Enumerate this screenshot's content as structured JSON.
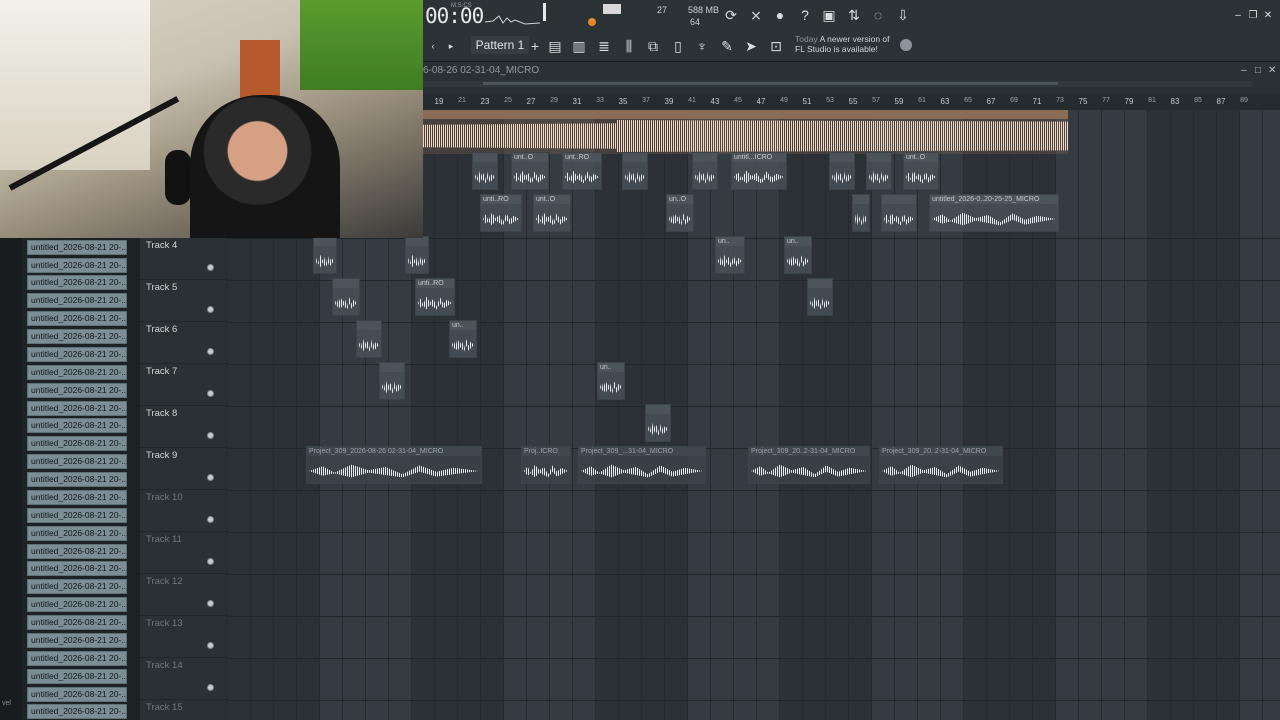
{
  "toolbar": {
    "time": "00:00",
    "time_unit": "M:S:CS",
    "tempo_value": "27",
    "memory": "588 MB",
    "cpu": "64",
    "pattern_label": "Pattern 1",
    "news_label": "Today",
    "news_text": "A newer version of FL Studio is available!"
  },
  "playlist": {
    "title": "6-08-26 02-31-04_MICRO"
  },
  "ruler": {
    "ticks": [
      "19",
      "21",
      "23",
      "25",
      "27",
      "29",
      "31",
      "33",
      "35",
      "37",
      "39",
      "41",
      "43",
      "45",
      "47",
      "49",
      "51",
      "53",
      "55",
      "57",
      "59",
      "61",
      "63",
      "65",
      "67",
      "69",
      "71",
      "73",
      "75",
      "77",
      "79",
      "81",
      "83",
      "85",
      "87",
      "89"
    ]
  },
  "browser": {
    "items": [
      "untitled_2026-08-21 20-...",
      "untitled_2026-08-21 20-...",
      "untitled_2026-08-21 20-...",
      "untitled_2026-08-21 20-...",
      "untitled_2026-08-21 20-...",
      "untitled_2026-08-21 20-...",
      "untitled_2026-08-21 20-...",
      "untitled_2026-08-21 20-...",
      "untitled_2026-08-21 20-...",
      "untitled_2026-08-21 20-...",
      "untitled_2026-08-21 20-...",
      "untitled_2026-08-21 20-...",
      "untitled_2026-08-21 20-...",
      "untitled_2026-08-21 20-...",
      "untitled_2026-08-21 20-...",
      "untitled_2026-08-21 20-...",
      "untitled_2026-08-21 20-...",
      "untitled_2026-08-21 20-...",
      "untitled_2026-08-21 20-...",
      "untitled_2026-08-21 20-...",
      "untitled_2026-08-21 20-...",
      "untitled_2026-08-21 20-...",
      "untitled_2026-08-21 20-...",
      "untitled_2026-08-21 20-...",
      "untitled_2026-08-21 20-...",
      "untitled_2026-08-21 20-...",
      "untitled_2026-08-21 20-..."
    ],
    "side_mark": "vel"
  },
  "tracks": [
    {
      "name": "Track 4",
      "active": true
    },
    {
      "name": "Track 5",
      "active": true
    },
    {
      "name": "Track 6",
      "active": true
    },
    {
      "name": "Track 7",
      "active": true
    },
    {
      "name": "Track 8",
      "active": true
    },
    {
      "name": "Track 9",
      "active": true
    },
    {
      "name": "Track 10",
      "active": false
    },
    {
      "name": "Track 11",
      "active": false
    },
    {
      "name": "Track 12",
      "active": false
    },
    {
      "name": "Track 13",
      "active": false
    },
    {
      "name": "Track 14",
      "active": false
    },
    {
      "name": "Track 15",
      "active": false
    }
  ],
  "clips": {
    "row1": [
      "unt..O",
      "unt..RO",
      "untitl...ICRO",
      "unt..O"
    ],
    "row2": [
      "unti..RO",
      "unt..O",
      "un..O",
      "untitled_2026-0..20-25-25_MICRO"
    ],
    "track5": [
      "unti..RO"
    ],
    "track9": [
      "Project_309_2026-08-26 02-31-04_MICRO",
      "Proj..ICRO",
      "Project_309_...31-04_MICRO",
      "Project_309_20..2-31-04_MICRO",
      "Project_309_20..2-31-04_MICRO"
    ],
    "un": "un.."
  },
  "icons": [
    "refresh-icon",
    "metronome-icon",
    "mic-icon",
    "help-icon",
    "save-icon",
    "mixer-icon",
    "chat-icon",
    "download-icon",
    "globe-icon"
  ]
}
